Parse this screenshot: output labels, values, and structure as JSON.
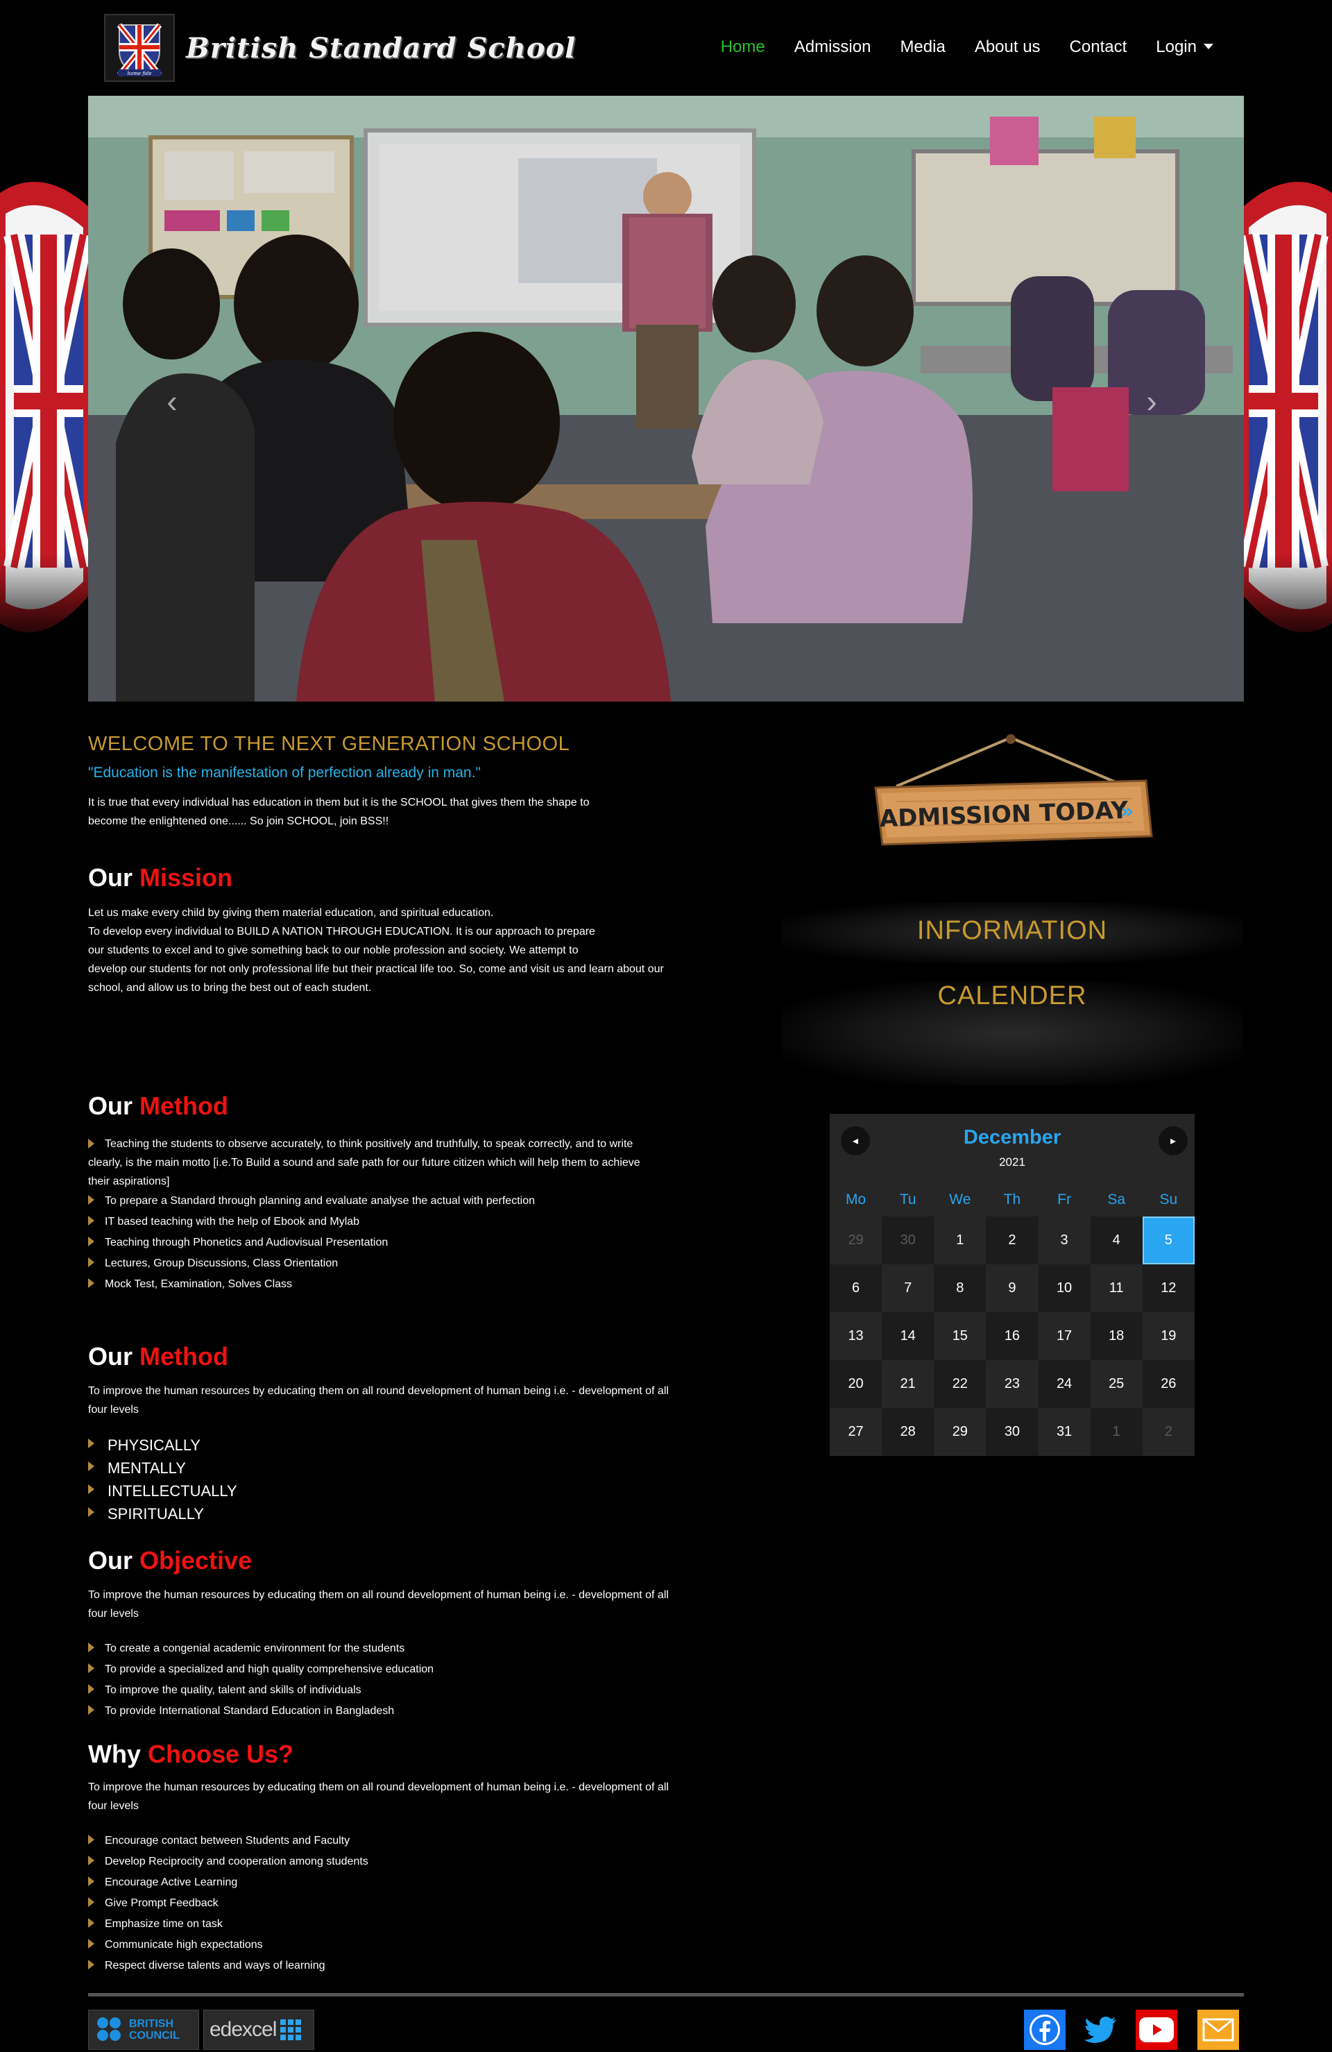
{
  "brand": {
    "name": "British Standard School",
    "crest_tagline": "home fide"
  },
  "nav": {
    "items": [
      "Home",
      "Admission",
      "Media",
      "About us",
      "Contact",
      "Login"
    ],
    "active": "Home"
  },
  "carousel": {
    "prev_glyph": "‹",
    "next_glyph": "›"
  },
  "welcome": {
    "title": "WELCOME TO THE NEXT GENERATION SCHOOL",
    "quote": "\"Education is the manifestation of perfection already in man.\"",
    "text_line1": "It is true that every individual has education in them but it is the SCHOOL that gives them the shape to",
    "text_line2": "become the enlightened one...... So join SCHOOL, join BSS!!"
  },
  "mission": {
    "title_plain": "Our ",
    "title_accent": "Mission",
    "lines": [
      "Let us make every child by giving them material education, and spiritual education.",
      "To develop every individual to BUILD A NATION THROUGH EDUCATION. It is our approach to prepare",
      "our students to excel and to give something back to our noble profession and society. We attempt to",
      "develop our students for not only professional life but their practical life too. So, come and visit us and learn about our",
      "school, and allow us to bring the best out of each student."
    ]
  },
  "method1": {
    "title_plain": "Our ",
    "title_accent": "Method",
    "first_item_lines": [
      "Teaching the students to observe accurately, to think positively and truthfully, to speak correctly, and      to write",
      "clearly, is the main motto [i.e.To Build a sound and safe path for our future citizen which will      help them to achieve",
      "their aspirations]"
    ],
    "items": [
      "To prepare a Standard through planning and evaluate analyse the actual with perfection",
      "IT based teaching with the help of Ebook and Mylab",
      "Teaching through Phonetics and Audiovisual Presentation",
      "Lectures, Group Discussions, Class Orientation",
      "Mock Test, Examination, Solves Class"
    ]
  },
  "method2": {
    "title_plain": "Our ",
    "title_accent": "Method",
    "intro_line1": "To improve the human resources by educating them on all round development of human being i.e. - development of all",
    "intro_line2": "four levels",
    "items": [
      "PHYSICALLY",
      "MENTALLY",
      "INTELLECTUALLY",
      "SPIRITUALLY"
    ]
  },
  "objective": {
    "title_plain": "Our ",
    "title_accent": "Objective",
    "intro_line1": "To improve the human resources by educating them on all round development of human being i.e. - development of all",
    "intro_line2": "four levels",
    "items": [
      "To create a congenial academic environment for the students",
      "To provide a specialized and high quality comprehensive education",
      "To improve the quality, talent and skills of individuals",
      "To provide International Standard Education in Bangladesh"
    ]
  },
  "why": {
    "title_plain": "Why ",
    "title_accent": "Choose Us?",
    "intro_line1": "To improve the human resources by educating them on all round development of human being i.e. - development of all",
    "intro_line2": "four levels",
    "items": [
      "Encourage contact between Students and Faculty",
      "Develop Reciprocity and cooperation among students",
      "Encourage Active Learning",
      "Give Prompt Feedback",
      "Emphasize time on task",
      "Communicate high expectations",
      "Respect diverse talents and ways of learning"
    ]
  },
  "sidebar": {
    "admission_sign": "ADMISSION TODAY",
    "information_label": "INFORMATION",
    "calendar_label": "CALENDER"
  },
  "calendar": {
    "month": "December",
    "year": "2021",
    "prev_glyph": "◂",
    "next_glyph": "▸",
    "weekdays": [
      "Mo",
      "Tu",
      "We",
      "Th",
      "Fr",
      "Sa",
      "Su"
    ],
    "days": [
      {
        "d": "29",
        "muted": true
      },
      {
        "d": "30",
        "muted": true
      },
      {
        "d": "1"
      },
      {
        "d": "2"
      },
      {
        "d": "3"
      },
      {
        "d": "4"
      },
      {
        "d": "5",
        "today": true
      },
      {
        "d": "6"
      },
      {
        "d": "7"
      },
      {
        "d": "8"
      },
      {
        "d": "9"
      },
      {
        "d": "10"
      },
      {
        "d": "11"
      },
      {
        "d": "12"
      },
      {
        "d": "13"
      },
      {
        "d": "14"
      },
      {
        "d": "15"
      },
      {
        "d": "16"
      },
      {
        "d": "17"
      },
      {
        "d": "18"
      },
      {
        "d": "19"
      },
      {
        "d": "20"
      },
      {
        "d": "21"
      },
      {
        "d": "22"
      },
      {
        "d": "23"
      },
      {
        "d": "24"
      },
      {
        "d": "25"
      },
      {
        "d": "26"
      },
      {
        "d": "27"
      },
      {
        "d": "28"
      },
      {
        "d": "29"
      },
      {
        "d": "30"
      },
      {
        "d": "31"
      },
      {
        "d": "1",
        "muted": true
      },
      {
        "d": "2",
        "muted": true
      }
    ],
    "colors": {
      "accent": "#2aa5ef",
      "panel": "#262626"
    }
  },
  "footer": {
    "partners": [
      "BRITISH COUNCIL",
      "edexcel"
    ],
    "social": [
      "facebook-icon",
      "twitter-icon",
      "youtube-icon",
      "email-icon"
    ]
  },
  "colors": {
    "gold": "#c89a2f",
    "quote_blue": "#27b4e8",
    "accent_red": "#ef1212",
    "nav_active": "#28c128"
  }
}
